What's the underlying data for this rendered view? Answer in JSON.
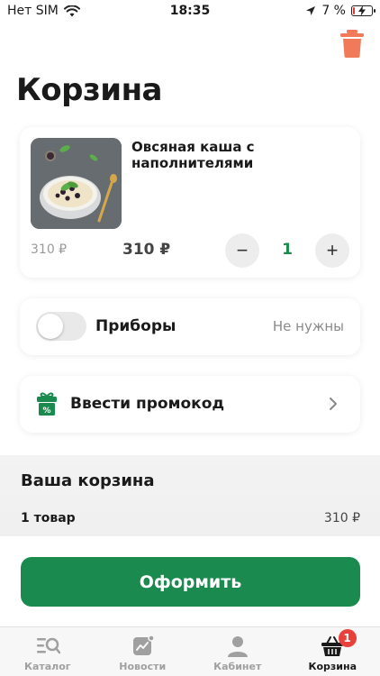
{
  "status_bar": {
    "carrier": "Нет SIM",
    "time": "18:35",
    "battery_percent": "7 %",
    "battery_level": 0.07,
    "battery_color": "#e53935"
  },
  "header": {
    "title": "Корзина",
    "trash_icon": "trash-icon",
    "trash_color": "#f07a5a"
  },
  "cart": {
    "items": [
      {
        "name": "Овсяная каша с наполнителями",
        "old_price": "310 ₽",
        "price": "310 ₽",
        "quantity": "1",
        "minus": "−",
        "plus": "+"
      }
    ]
  },
  "options": {
    "cutlery_label": "Приборы",
    "cutlery_value": "Не нужны",
    "cutlery_enabled": false,
    "promo_label": "Ввести промокод",
    "promo_icon": "gift-icon"
  },
  "summary": {
    "title": "Ваша корзина",
    "item_count": "1 товар",
    "total": "310 ₽"
  },
  "checkout": {
    "label": "Оформить",
    "color": "#1b8a4e"
  },
  "tab_bar": {
    "tabs": [
      {
        "label": "Каталог",
        "icon": "catalog-search-icon"
      },
      {
        "label": "Новости",
        "icon": "news-chart-icon"
      },
      {
        "label": "Кабинет",
        "icon": "user-icon"
      },
      {
        "label": "Корзина",
        "icon": "basket-icon",
        "badge": "1",
        "active": true
      }
    ]
  }
}
